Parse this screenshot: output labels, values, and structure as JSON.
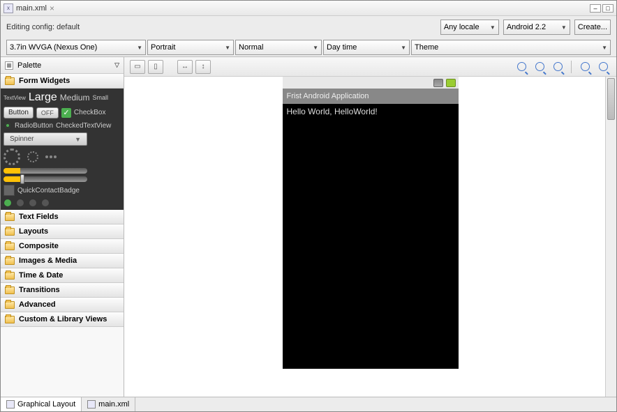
{
  "tab": {
    "title": "main.xml"
  },
  "config": {
    "label": "Editing config:  default",
    "locale": "Any locale",
    "android_version": "Android 2.2",
    "create_button": "Create..."
  },
  "selectors": {
    "device": "3.7in WVGA (Nexus One)",
    "orientation": "Portrait",
    "dock_mode": "Normal",
    "day_night": "Day time",
    "theme": "Theme"
  },
  "palette": {
    "header": "Palette",
    "categories": [
      "Form Widgets",
      "Text Fields",
      "Layouts",
      "Composite",
      "Images & Media",
      "Time & Date",
      "Transitions",
      "Advanced",
      "Custom & Library Views"
    ],
    "widgets": {
      "textview": "TextView",
      "large": "Large",
      "medium": "Medium",
      "small": "Small",
      "button": "Button",
      "off": "OFF",
      "checkbox": "CheckBox",
      "radiobutton": "RadioButton",
      "checkedtextview": "CheckedTextView",
      "spinner": "Spinner",
      "quickcontact": "QuickContactBadge"
    }
  },
  "device_preview": {
    "app_title": "Frist Android Application",
    "content_text": "Hello World, HelloWorld!"
  },
  "bottom_tabs": {
    "graphical": "Graphical Layout",
    "xml": "main.xml"
  }
}
